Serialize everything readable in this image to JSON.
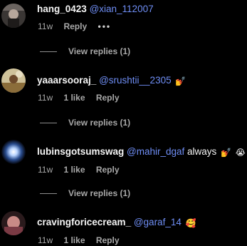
{
  "comments": [
    {
      "username": "hang_0423",
      "mention": "@xian_112007",
      "text": "",
      "emojis": [],
      "time": "11w",
      "likes": "",
      "reply_label": "Reply",
      "more_label": "•••"
    },
    {
      "username": "yaaarsooraj_",
      "mention": "@srushtii__2305",
      "text": "",
      "emojis": [
        "💅"
      ],
      "time": "11w",
      "likes": "1 like",
      "reply_label": "Reply"
    },
    {
      "username": "lubinsgotsumswag",
      "mention": "@mahir_dgaf",
      "text": "always",
      "emojis": [
        "💅",
        "😭"
      ],
      "time": "11w",
      "likes": "1 like",
      "reply_label": "Reply"
    },
    {
      "username": "cravingforicecream_",
      "mention": "@garaf_14",
      "text": "",
      "emojis": [
        "🥰"
      ],
      "time": "11w",
      "likes": "1 like",
      "reply_label": "Reply"
    }
  ],
  "view_replies": [
    {
      "label": "View replies (1)"
    },
    {
      "label": "View replies (1)"
    },
    {
      "label": "View replies (1)"
    }
  ],
  "colors": {
    "background": "#000000",
    "text": "#f5f5f5",
    "mention": "#6f8ef5",
    "meta": "#a8a8a8"
  }
}
